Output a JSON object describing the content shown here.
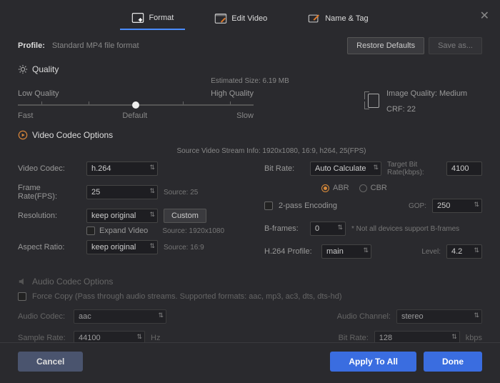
{
  "tabs": {
    "format": "Format",
    "edit": "Edit Video",
    "name": "Name & Tag"
  },
  "profile": {
    "label": "Profile:",
    "value": "Standard MP4 file format"
  },
  "buttons": {
    "restore": "Restore Defaults",
    "saveas": "Save as..."
  },
  "quality": {
    "title": "Quality",
    "est": "Estimated Size: 6.19 MB",
    "low": "Low Quality",
    "high": "High Quality",
    "fast": "Fast",
    "default": "Default",
    "slow": "Slow",
    "iq": "Image Quality: Medium",
    "crf": "CRF: 22"
  },
  "video": {
    "title": "Video Codec Options",
    "sourceinfo": "Source Video Stream Info: 1920x1080, 16:9, h264, 25(FPS)",
    "codec_l": "Video Codec:",
    "codec": "h.264",
    "fps_l": "Frame Rate(FPS):",
    "fps": "25",
    "fps_src": "Source: 25",
    "res_l": "Resolution:",
    "res": "keep original",
    "custom": "Custom",
    "expand": "Expand Video",
    "res_src": "Source: 1920x1080",
    "ar_l": "Aspect Ratio:",
    "ar": "keep original",
    "ar_src": "Source: 16:9",
    "br_l": "Bit Rate:",
    "br": "Auto Calculate",
    "tbr_l": "Target Bit Rate(kbps):",
    "tbr": "4100",
    "abr": "ABR",
    "cbr": "CBR",
    "twopass": "2-pass Encoding",
    "gop_l": "GOP:",
    "gop": "250",
    "bf_l": "B-frames:",
    "bf": "0",
    "notall": "* Not all devices support B-frames",
    "profile_l": "H.264 Profile:",
    "profile": "main",
    "level_l": "Level:",
    "level": "4.2"
  },
  "audio": {
    "title": "Audio Codec Options",
    "force": "Force Copy (Pass through audio streams. Supported formats: aac, mp3, ac3, dts, dts-hd)",
    "codec_l": "Audio Codec:",
    "codec": "aac",
    "ch_l": "Audio Channel:",
    "ch": "stereo",
    "sr_l": "Sample Rate:",
    "sr": "44100",
    "hz": "Hz",
    "br_l": "Bit Rate:",
    "br": "128",
    "kbps": "kbps"
  },
  "footer": {
    "cancel": "Cancel",
    "apply": "Apply To All",
    "done": "Done"
  }
}
